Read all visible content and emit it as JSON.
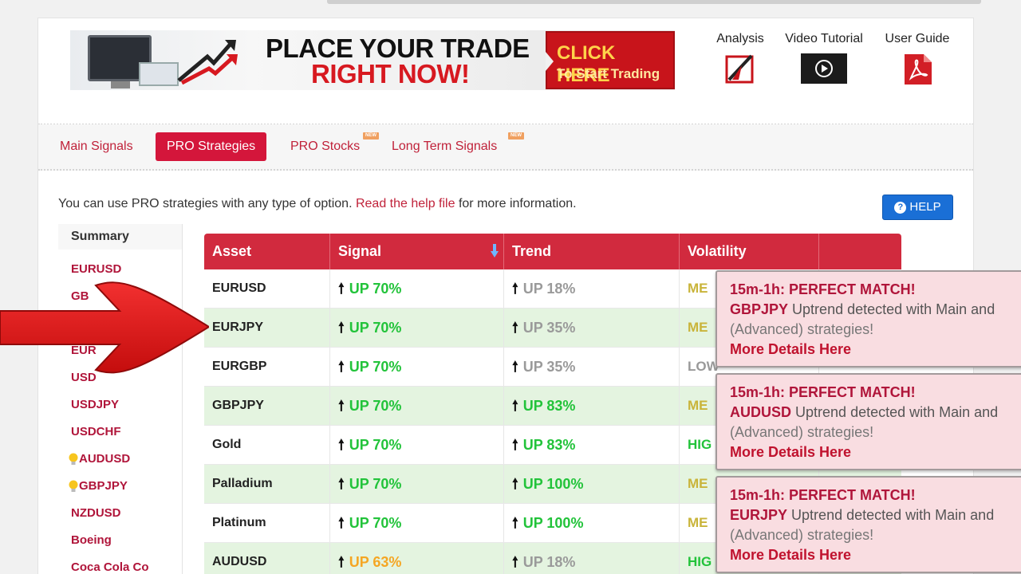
{
  "banner": {
    "headline_1": "PLACE YOUR TRADE",
    "headline_2": "RIGHT NOW!",
    "cta_line_1": "CLICK HERE",
    "cta_line_2": "To Start Trading"
  },
  "tools": [
    {
      "label": "Analysis",
      "icon": "analysis-icon"
    },
    {
      "label": "Video Tutorial",
      "icon": "play-video-icon"
    },
    {
      "label": "User Guide",
      "icon": "pdf-icon"
    }
  ],
  "tabs": [
    {
      "label": "Main Signals",
      "active": false,
      "new": false
    },
    {
      "label": "PRO Strategies",
      "active": true,
      "new": false
    },
    {
      "label": "PRO Stocks",
      "active": false,
      "new": true
    },
    {
      "label": "Long Term Signals",
      "active": false,
      "new": true
    }
  ],
  "new_badge": "NEW",
  "info": {
    "prefix": "You can use PRO strategies with any type of option.",
    "link": "Read the help file",
    "suffix": "for more information."
  },
  "help_button": {
    "icon": "question-icon",
    "label": "HELP",
    "q": "?"
  },
  "sidebar": {
    "title": "Summary",
    "items": [
      {
        "label": "EURUSD",
        "bulb": false
      },
      {
        "label": "GB",
        "bulb": false
      },
      {
        "label": "",
        "bulb": true
      },
      {
        "label": "EUR",
        "bulb": false
      },
      {
        "label": "USD",
        "bulb": false
      },
      {
        "label": "USDJPY",
        "bulb": false
      },
      {
        "label": "USDCHF",
        "bulb": false
      },
      {
        "label": "AUDUSD",
        "bulb": true
      },
      {
        "label": "GBPJPY",
        "bulb": true
      },
      {
        "label": "NZDUSD",
        "bulb": false
      },
      {
        "label": "Boeing",
        "bulb": false
      },
      {
        "label": "Coca Cola Co",
        "bulb": false
      }
    ]
  },
  "table": {
    "headers": [
      "Asset",
      "Signal",
      "Trend",
      "Volatility",
      ""
    ],
    "sort_icon": "sort-down-icon",
    "arrow_glyph": "🠕",
    "rows": [
      {
        "asset": "EURUSD",
        "signal": "UP 70%",
        "signal_color": "green",
        "trend": "UP 18%",
        "trend_color": "gray",
        "vol": "ME",
        "vol_color": "#c9b43a"
      },
      {
        "asset": "EURJPY",
        "signal": "UP 70%",
        "signal_color": "green",
        "trend": "UP 35%",
        "trend_color": "gray",
        "vol": "ME",
        "vol_color": "#c9b43a"
      },
      {
        "asset": "EURGBP",
        "signal": "UP 70%",
        "signal_color": "green",
        "trend": "UP 35%",
        "trend_color": "gray",
        "vol": "LOW",
        "vol_color": "#999999"
      },
      {
        "asset": "GBPJPY",
        "signal": "UP 70%",
        "signal_color": "green",
        "trend": "UP 83%",
        "trend_color": "green",
        "vol": "ME",
        "vol_color": "#c9b43a"
      },
      {
        "asset": "Gold",
        "signal": "UP 70%",
        "signal_color": "green",
        "trend": "UP 83%",
        "trend_color": "green",
        "vol": "HIG",
        "vol_color": "#22c33a"
      },
      {
        "asset": "Palladium",
        "signal": "UP 70%",
        "signal_color": "green",
        "trend": "UP 100%",
        "trend_color": "green",
        "vol": "ME",
        "vol_color": "#c9b43a"
      },
      {
        "asset": "Platinum",
        "signal": "UP 70%",
        "signal_color": "green",
        "trend": "UP 100%",
        "trend_color": "green",
        "vol": "ME",
        "vol_color": "#c9b43a"
      },
      {
        "asset": "AUDUSD",
        "signal": "UP 63%",
        "signal_color": "orange",
        "trend": "UP 18%",
        "trend_color": "gray",
        "vol": "HIG",
        "vol_color": "#22c33a"
      }
    ]
  },
  "notifications": [
    {
      "title": "15m-1h: PERFECT MATCH!",
      "asset": "GBPJPY",
      "line2": "Uptrend detected with Main and",
      "line3": "(Advanced) strategies!",
      "link": "More Details Here"
    },
    {
      "title": "15m-1h: PERFECT MATCH!",
      "asset": "AUDUSD",
      "line2": "Uptrend detected with Main and",
      "line3": "(Advanced) strategies!",
      "link": "More Details Here"
    },
    {
      "title": "15m-1h: PERFECT MATCH!",
      "asset": "EURJPY",
      "line2": "Uptrend detected with Main and",
      "line3": "(Advanced) strategies!",
      "link": "More Details Here"
    }
  ],
  "colors": {
    "brand_red": "#d12a3e",
    "up_green": "#22c33a",
    "up_gray": "#9a9a9a",
    "up_orange": "#f5a623",
    "help_blue": "#1a6fd6"
  }
}
